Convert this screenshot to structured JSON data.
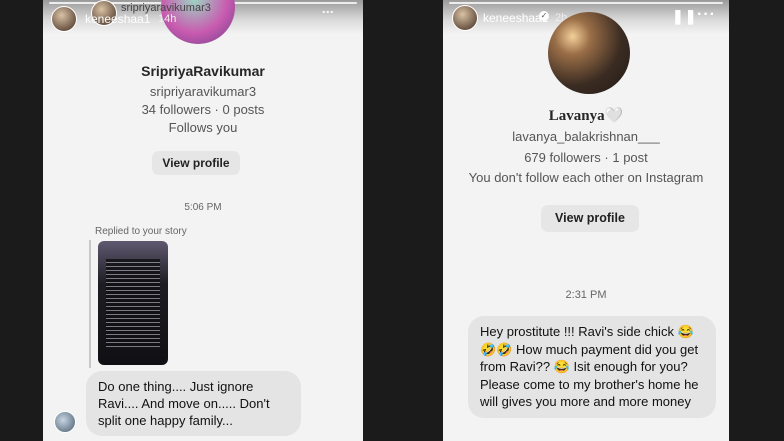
{
  "left": {
    "top_handle": "sripriyaravikumar3",
    "story_user": "keneeshaa1",
    "story_time": "14h",
    "profile": {
      "display_name": "SripriyaRavikumar",
      "username": "sripriyaravikumar3",
      "stats": "34 followers · 0 posts",
      "relation": "Follows you",
      "button": "View profile"
    },
    "timestamp": "5:06 PM",
    "replied_label": "Replied to your story",
    "message": "Do one thing.... Just ignore Ravi.... And move on..... Don't split one happy family..."
  },
  "right": {
    "story_user": "keneeshaa1",
    "story_time": "2h",
    "profile": {
      "display_name": "Lavanya🤍",
      "username": "lavanya_balakrishnan___",
      "stats": "679 followers · 1 post",
      "relation": "You don't follow each other on Instagram",
      "button": "View profile"
    },
    "timestamp": "2:31 PM",
    "message": "Hey prostitute !!! Ravi's side chick 😂🤣🤣 How much payment did you get from Ravi?? 😂 Isit enough for you? Please come to my brother's home he will gives you more and more money"
  },
  "icons": [
    "verified-icon",
    "pause-icon",
    "more-icon"
  ]
}
